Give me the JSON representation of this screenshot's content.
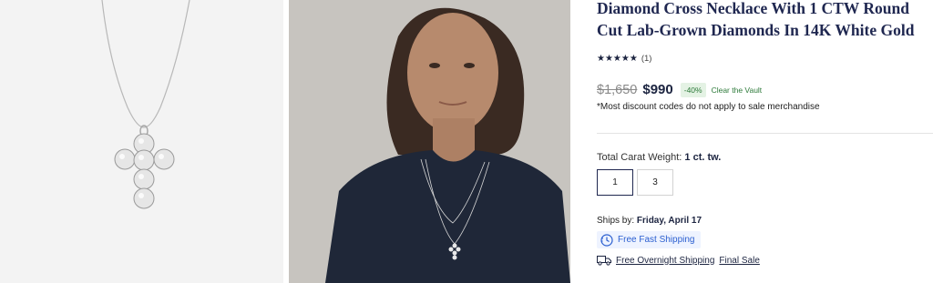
{
  "gallery": {
    "images": [
      {
        "name": "product-photo",
        "alt": "Diamond cross pendant on chain"
      },
      {
        "name": "model-photo",
        "alt": "Model wearing diamond cross necklace"
      }
    ]
  },
  "product": {
    "title": "Diamond Cross Necklace With 1 CTW Round Cut Lab-Grown Diamonds In 14K White Gold",
    "rating": {
      "stars": "★★★★★",
      "count": "(1)",
      "value": 5
    },
    "price": {
      "original": "$1,650",
      "sale": "$990",
      "discount": "-40%",
      "sale_name": "Clear the Vault"
    },
    "disclaimer": "*Most discount codes do not apply to sale merchandise"
  },
  "carat": {
    "label": "Total Carat Weight:",
    "selected_value": "1 ct. tw.",
    "options": [
      "1",
      "3"
    ]
  },
  "shipping": {
    "ships_by_label": "Ships by:",
    "ships_by_date": "Friday, April 17",
    "free_fast": "Free Fast Shipping",
    "overnight": "Free Overnight Shipping",
    "final_sale": "Final Sale"
  },
  "colors": {
    "title": "#1f2750",
    "discount_green": "#2d7a3a",
    "shipping_blue": "#2b5fd0"
  }
}
